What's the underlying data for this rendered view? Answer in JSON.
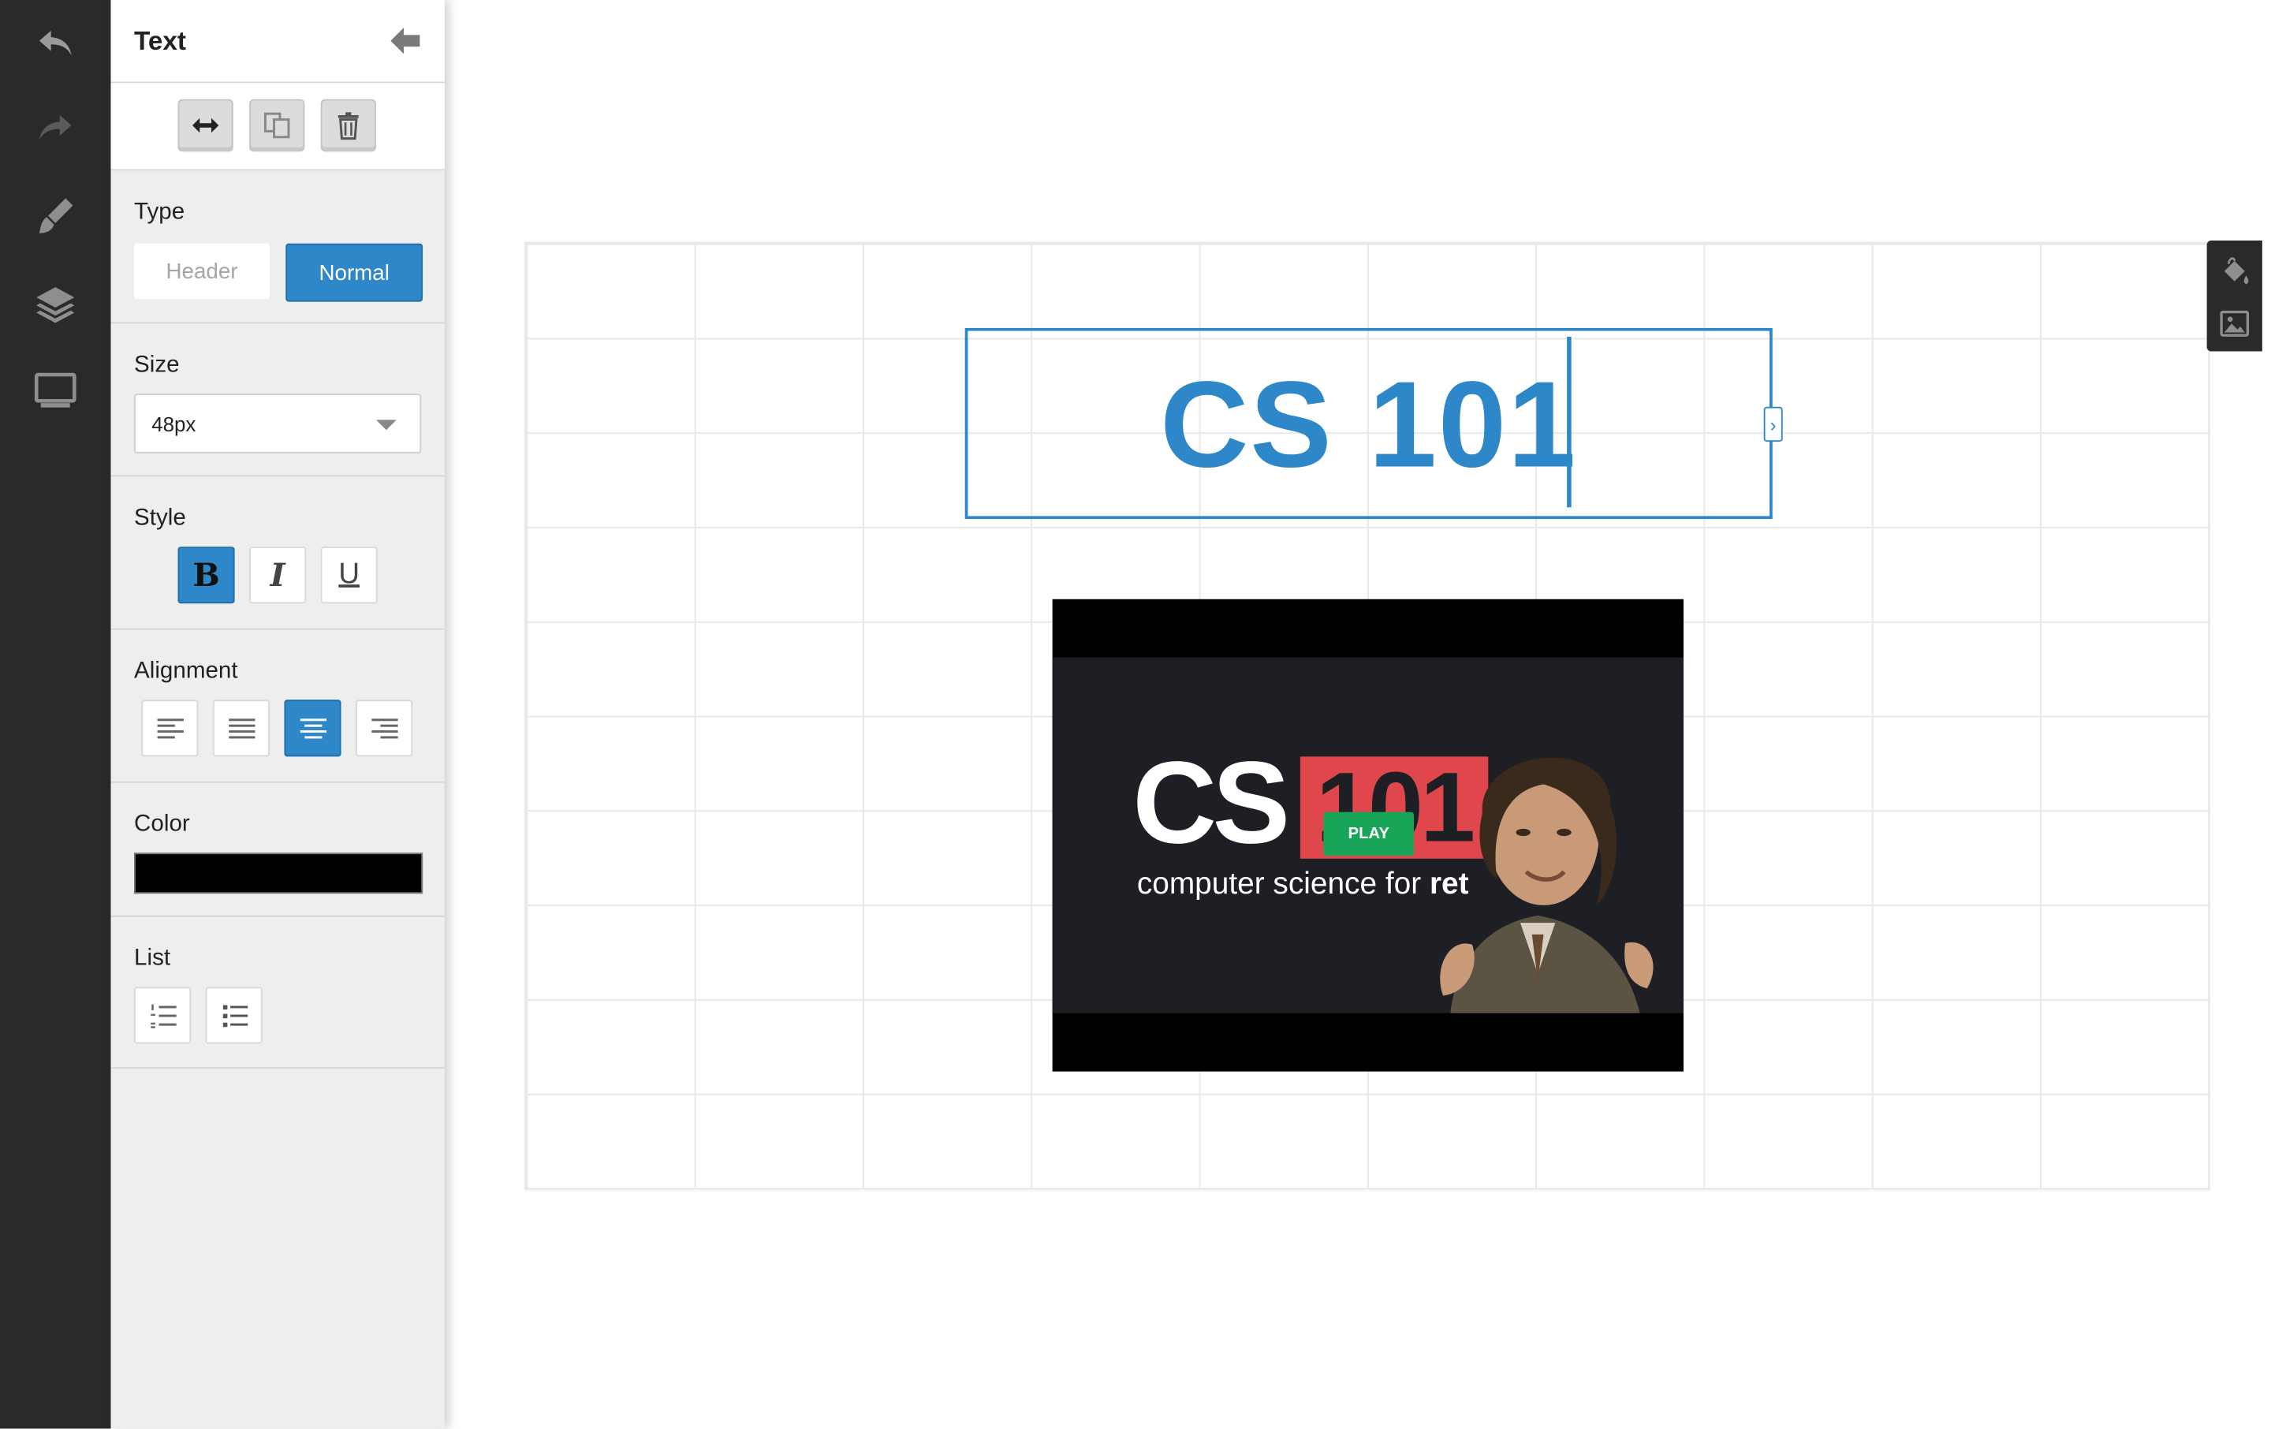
{
  "panel": {
    "title": "Text",
    "type": {
      "label": "Type",
      "options": [
        "Header",
        "Normal"
      ],
      "selected": "Normal"
    },
    "size": {
      "label": "Size",
      "value": "48px"
    },
    "style": {
      "label": "Style",
      "bold": "B",
      "italic": "I",
      "underline": "U",
      "active": "bold"
    },
    "alignment": {
      "label": "Alignment",
      "options": [
        "left",
        "justify",
        "center",
        "right"
      ],
      "selected": "center"
    },
    "color": {
      "label": "Color",
      "value": "#000000"
    },
    "list": {
      "label": "List",
      "options": [
        "numbered",
        "bulleted"
      ]
    }
  },
  "toolbar": {
    "items": [
      "undo-icon",
      "redo-icon",
      "brush-icon",
      "layers-icon",
      "monitor-icon"
    ]
  },
  "canvas": {
    "text_block": "CS 101",
    "text_color": "#2d87c8",
    "video": {
      "title_cs": "CS",
      "title_num": "101",
      "subtitle": "computer science for ",
      "subtitle_bold": "ret",
      "play_label": "PLAY"
    }
  },
  "colors": {
    "accent": "#2d87c8",
    "toolbar_bg": "#2a2a2a",
    "panel_bg": "#eeeeee",
    "badge_red": "#e0474c",
    "play_green": "#19a558"
  }
}
